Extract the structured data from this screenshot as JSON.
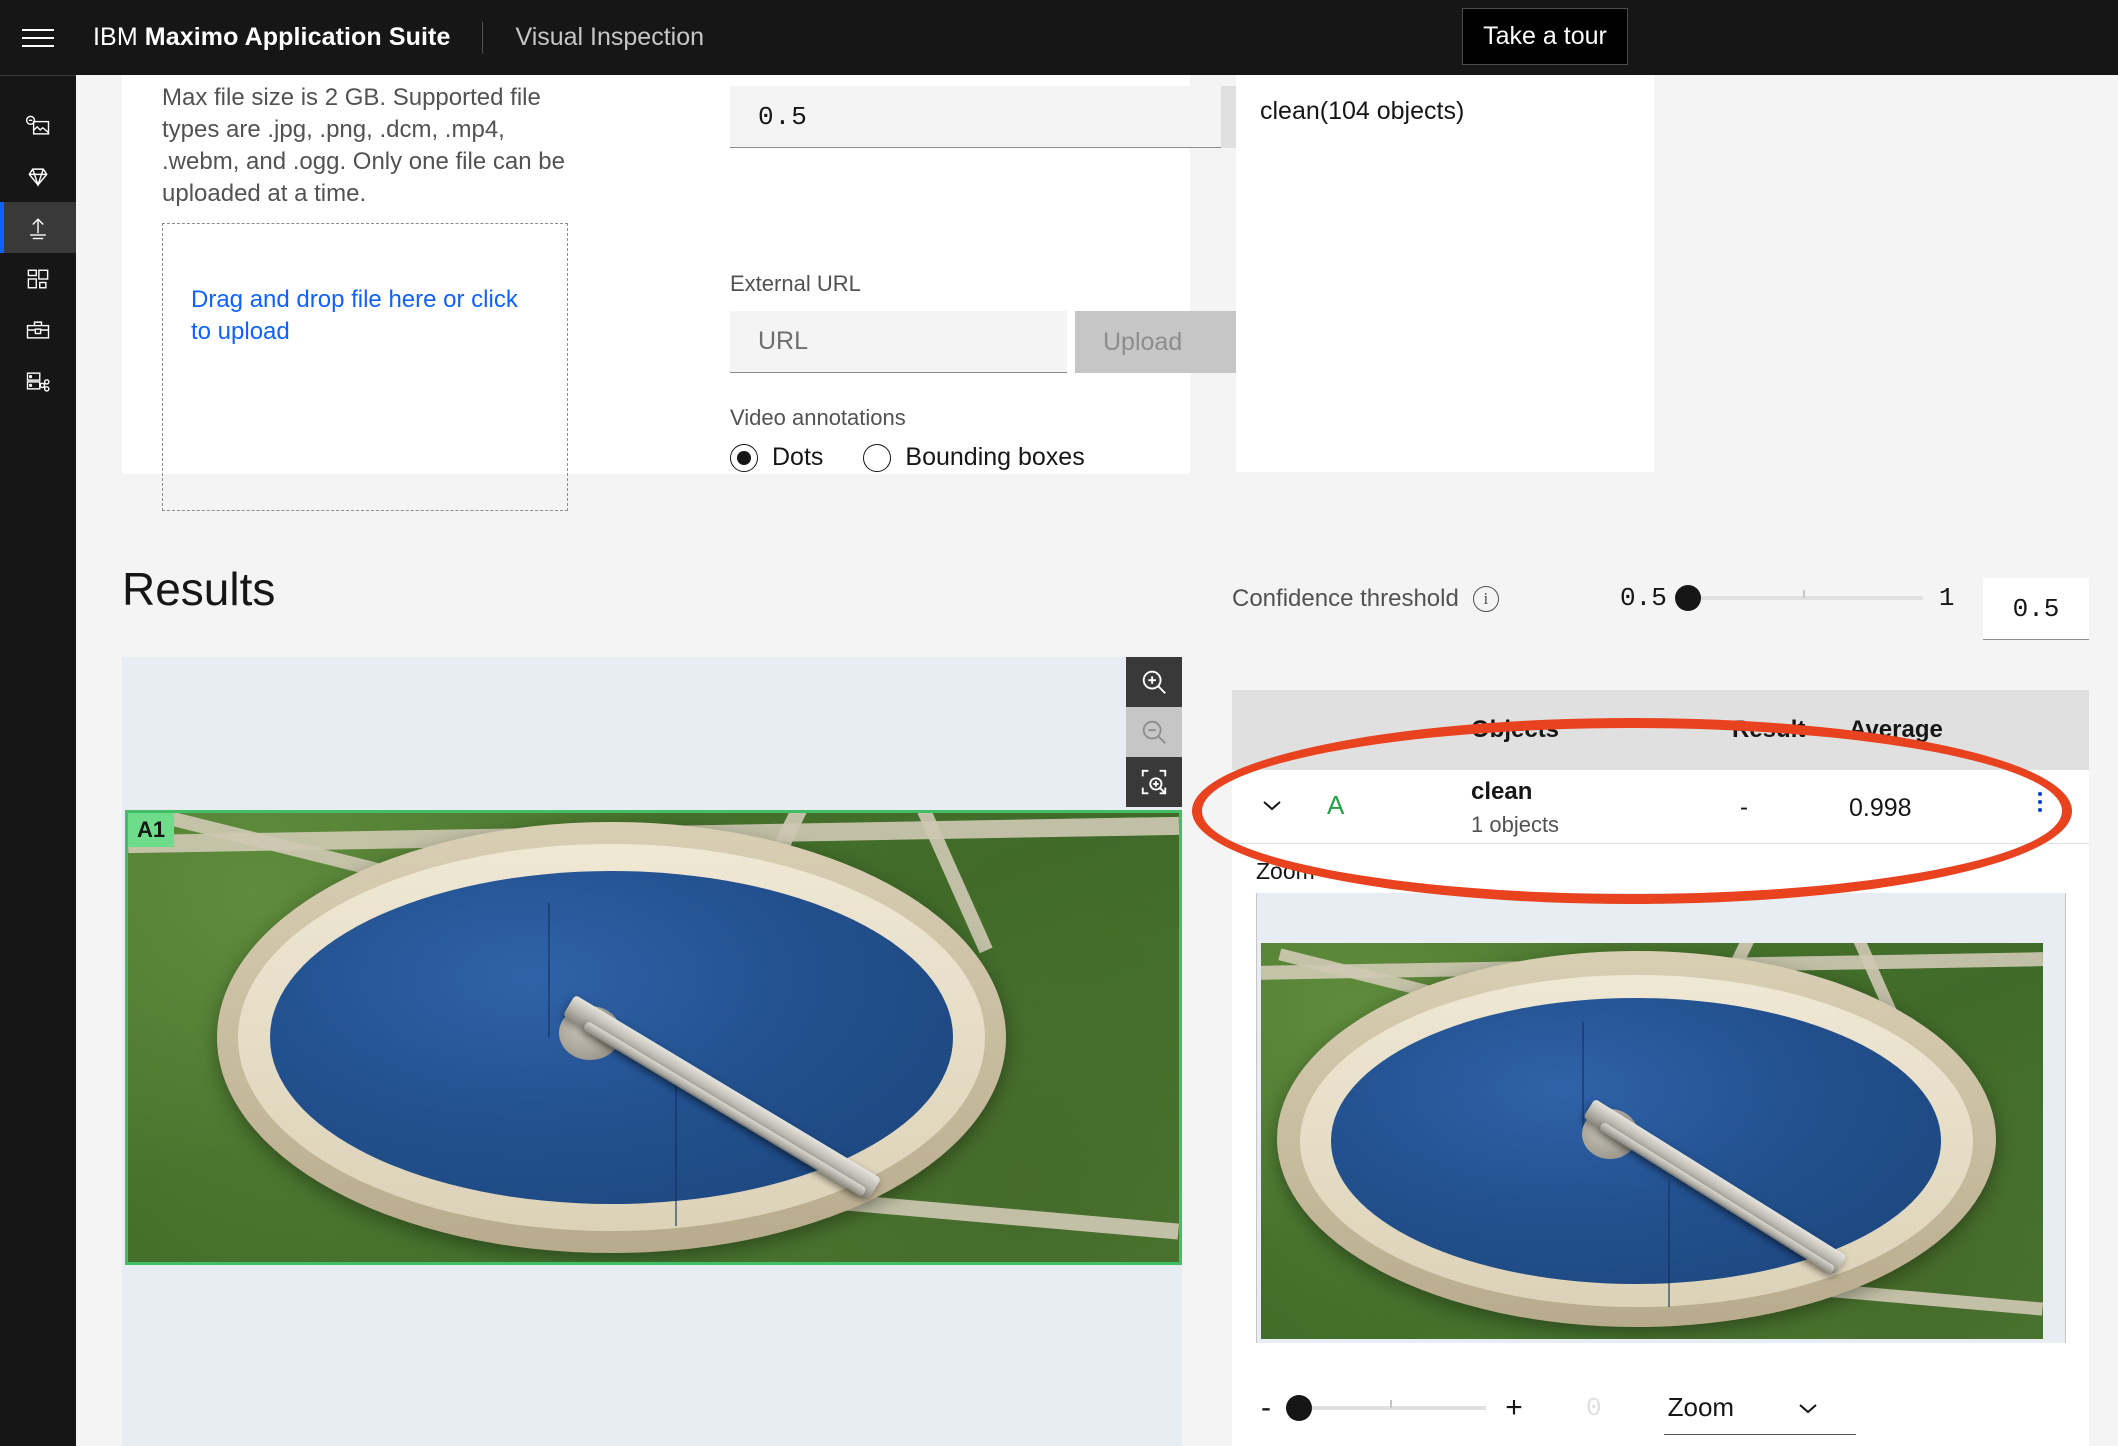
{
  "header": {
    "menu_icon": "hamburger-icon",
    "brand_prefix": "IBM",
    "brand_name": "Maximo Application Suite",
    "product": "Visual Inspection",
    "take_tour_label": "Take a tour"
  },
  "sidebar": {
    "items": [
      {
        "name": "images",
        "icon": "image-tag-icon",
        "active": false
      },
      {
        "name": "models",
        "icon": "diamond-icon",
        "active": false
      },
      {
        "name": "deploy-upload",
        "icon": "upload-icon",
        "active": true
      },
      {
        "name": "projects",
        "icon": "grid-layout-icon",
        "active": false
      },
      {
        "name": "toolbox",
        "icon": "toolbox-icon",
        "active": false
      },
      {
        "name": "deployed-models",
        "icon": "server-share-icon",
        "active": false
      }
    ]
  },
  "upload_panel": {
    "helper_text": "Max file size is 2 GB. Supported file types are .jpg, .png, .dcm, .mp4, .webm, and .ogg. Only one file can be uploaded at a time.",
    "dropzone_label": "Drag and drop file here or click to upload",
    "number_value": "0.5",
    "external_url_label": "External URL",
    "url_placeholder": "URL",
    "upload_button_label": "Upload",
    "video_annotations_label": "Video annotations",
    "radio_options": [
      {
        "label": "Dots",
        "selected": true
      },
      {
        "label": "Bounding boxes",
        "selected": false
      }
    ]
  },
  "objects_panel": {
    "summary": "clean(104 objects)"
  },
  "results": {
    "title": "Results",
    "confidence": {
      "label": "Confidence threshold",
      "info_icon": "info-icon",
      "min": "0.5",
      "max": "1",
      "value": "0.5"
    },
    "viewer": {
      "tools": [
        {
          "name": "zoom-in-icon",
          "enabled": true
        },
        {
          "name": "zoom-out-icon",
          "enabled": false
        },
        {
          "name": "zoom-to-fit-icon",
          "enabled": true
        }
      ],
      "bbox_label": "A1"
    },
    "table": {
      "columns": [
        "Objects",
        "Result",
        "Average"
      ],
      "rows": [
        {
          "expand_icon": "chevron-down-icon",
          "tag": "A",
          "object_name": "clean",
          "object_count": "1 objects",
          "result": "-",
          "average": "0.998",
          "overflow_icon": "kebab-menu-icon"
        }
      ]
    },
    "detail": {
      "zoom_caption": "Zoom",
      "zoom_minus": "-",
      "zoom_plus": "+",
      "zoom_value": "0",
      "zoom_select_label": "Zoom",
      "zoom_select_icon": "chevron-down-icon"
    }
  },
  "annotation": {
    "shape": "ellipse-highlight",
    "color": "#e8421f"
  }
}
